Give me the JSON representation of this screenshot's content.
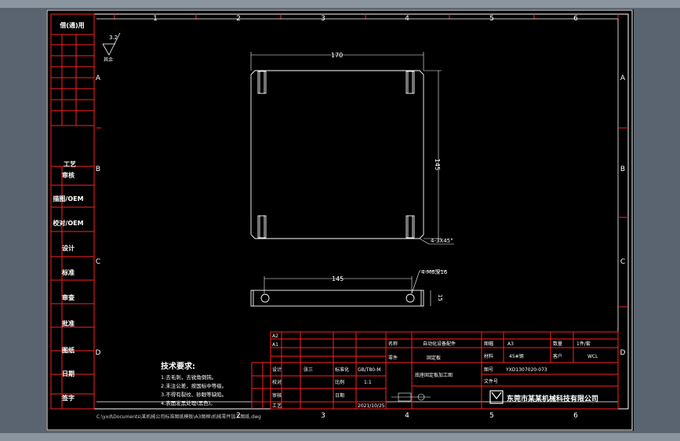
{
  "zones": {
    "columns": [
      "1",
      "2",
      "3",
      "4",
      "5",
      "6"
    ],
    "rows": [
      "A",
      "B",
      "C",
      "D"
    ]
  },
  "left_strip": {
    "labels": [
      "借(通)用",
      "工艺",
      "审核",
      "描图/OEM",
      "校对/OEM",
      "设计",
      "标准",
      "审查",
      "批准",
      "图纸",
      "日期",
      "签字"
    ]
  },
  "surface_symbol": {
    "value": "3.2",
    "note": "其余"
  },
  "plan_view": {
    "width_dim": "170",
    "height_dim": "145",
    "chamfer_note": "4-3X45°"
  },
  "side_view": {
    "length_dim": "145",
    "hole_note": "4-M6深16",
    "thickness_dim": "15"
  },
  "tech_requirements": {
    "title": "技术要求:",
    "lines": [
      "1.去毛刺，去锐角倒钝。",
      "2.未注公差，按国标中等级。",
      "3.不得有裂纹、砂眼等缺陷。",
      "4.表面发黑处理(黑色)。"
    ]
  },
  "title_block": {
    "rev_rows": [
      "A2",
      "A1"
    ],
    "sign_labels": [
      "设计",
      "校对",
      "审核",
      "工艺"
    ],
    "sign_name": "张三",
    "material_label": "标准化",
    "material_value": "GB/T80-M",
    "scale_label": "比例",
    "scale_value": "1:1",
    "date_label": "日期",
    "date_value": "2021/10/25",
    "product_label": "名称",
    "product_value": "自动化设备配件",
    "part_label": "零件",
    "part_value": "固定板",
    "drawing_name": "底座固定板加工图",
    "size_label": "图幅",
    "size_value": "A3",
    "qty_label": "数量",
    "qty_value": "1件/套",
    "material2_label": "材料",
    "material2_value": "45#钢",
    "client_label": "客户",
    "client_value": "WCL",
    "drawing_no_label": "图号",
    "drawing_no_value": "YXD1307020-073",
    "file_label": "文件号",
    "file_value": "",
    "company": "东莞市某某机械科技有限公司"
  },
  "footer_path": "C:\\yxd\\Documents\\某机械公司标准图纸模板\\A3图框\\机械零件加工图纸.dwg"
}
